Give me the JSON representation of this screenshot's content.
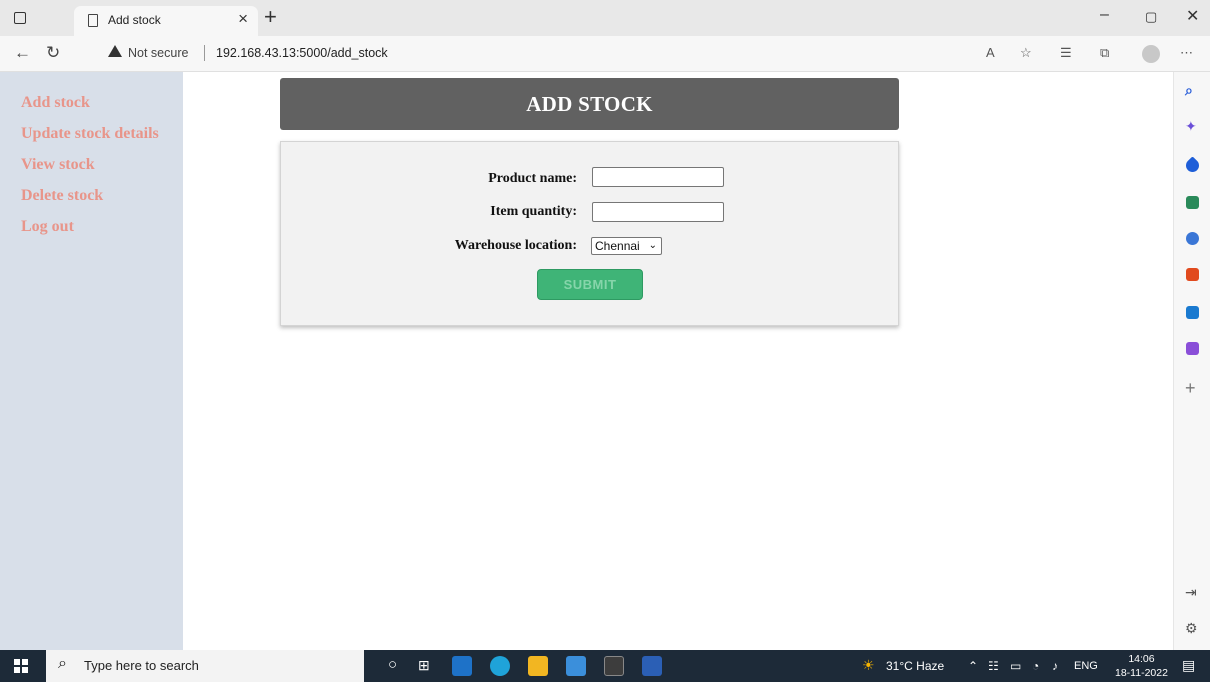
{
  "browser": {
    "tab_title": "Add stock",
    "security_label": "Not secure",
    "url": "192.168.43.13:5000/add_stock"
  },
  "sidebar": {
    "items": [
      {
        "label": "Add stock"
      },
      {
        "label": "Update stock details"
      },
      {
        "label": "View stock"
      },
      {
        "label": "Delete stock"
      },
      {
        "label": "Log out"
      }
    ]
  },
  "form": {
    "title": "ADD STOCK",
    "product_name_label": "Product name:",
    "item_quantity_label": "Item quantity:",
    "warehouse_label": "Warehouse location:",
    "warehouse_selected": "Chennai",
    "submit_label": "SUBMIT",
    "submit_color": "#3fb477"
  },
  "taskbar": {
    "search_placeholder": "Type here to search",
    "weather": "31°C  Haze",
    "language": "ENG",
    "time": "14:06",
    "date": "18-11-2022"
  }
}
